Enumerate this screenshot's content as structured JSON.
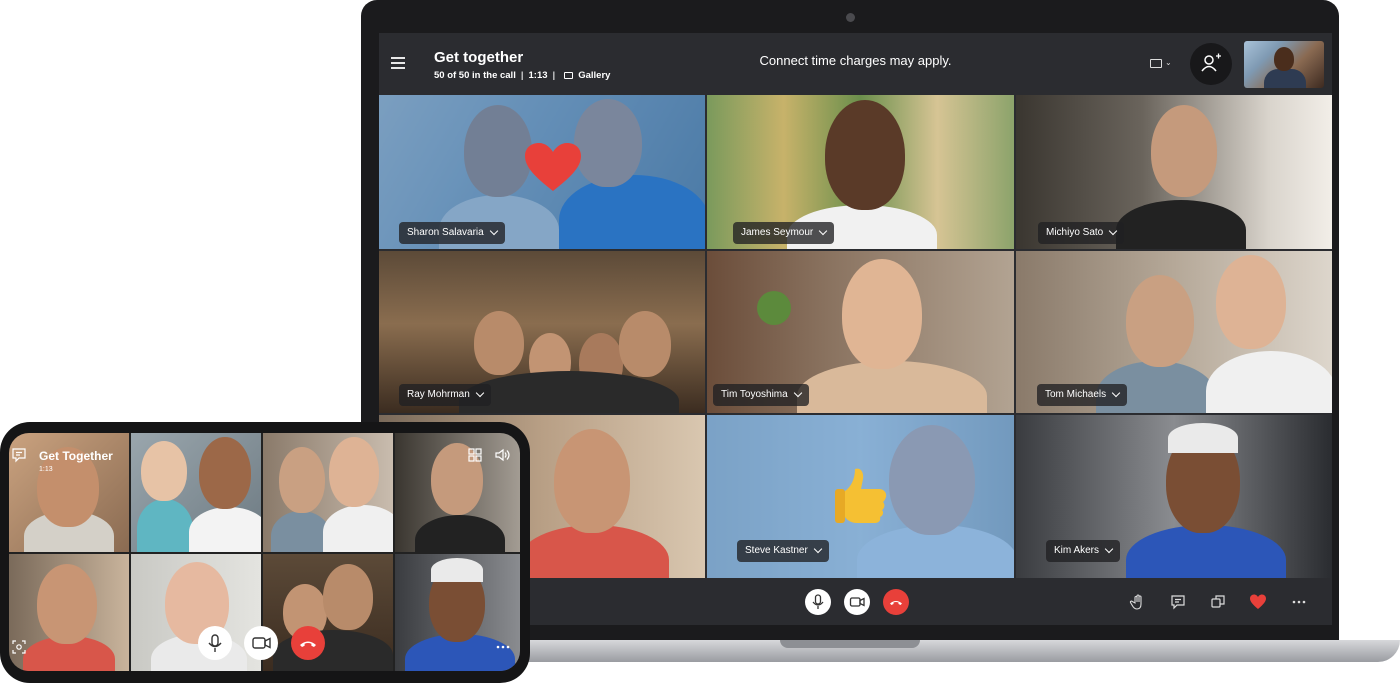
{
  "desktop": {
    "header": {
      "title": "Get together",
      "participants": "50 of 50 in the call",
      "duration": "1:13",
      "view_mode": "Gallery",
      "notice": "Connect time charges may apply."
    },
    "participants": [
      {
        "name": "Sharon Salavaria",
        "reaction": "heart"
      },
      {
        "name": "James Seymour"
      },
      {
        "name": "Michiyo Sato"
      },
      {
        "name": "Ray Mohrman"
      },
      {
        "name": "Tim Toyoshima"
      },
      {
        "name": "Tom Michaels"
      },
      {
        "name": ""
      },
      {
        "name": "Steve Kastner",
        "reaction": "thumbs-up"
      },
      {
        "name": "Kim Akers"
      }
    ],
    "controls": {
      "call": [
        "mic-icon",
        "video-camera-icon",
        "end-call-icon"
      ],
      "right": [
        "raise-hand-icon",
        "chat-icon",
        "switch-view-icon",
        "heart-reaction-icon",
        "more-options-icon"
      ]
    },
    "colors": {
      "accent_red": "#e8403a",
      "highlight_blue": "#2678c8",
      "surface": "#2b2c30"
    }
  },
  "mobile": {
    "title": "Get Together",
    "duration": "1:13",
    "icons": [
      "chat-icon",
      "grid-view-icon",
      "speaker-icon",
      "screenshot-icon",
      "more-options-icon"
    ],
    "controls": [
      "mic-icon",
      "video-camera-icon",
      "end-call-icon"
    ]
  }
}
